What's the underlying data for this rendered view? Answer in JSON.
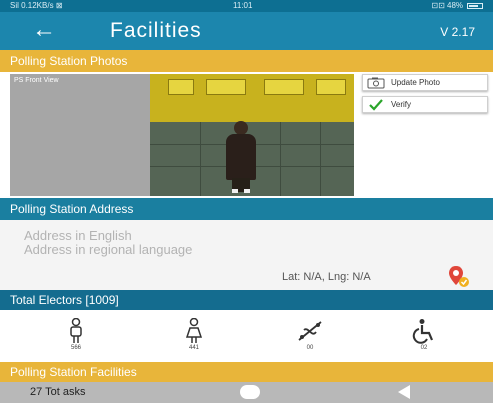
{
  "status_bar": {
    "left_text": "Sil 0.12KB/s ⊠",
    "time": "11:01",
    "right_text": "⊡⊡ 48%"
  },
  "app_bar": {
    "back_icon": "back-arrow-icon",
    "title": "Facilities",
    "version": "V 2.17"
  },
  "photos_section": {
    "header": "Polling Station Photos",
    "label": "PS Front View",
    "update_button": "Update Photo",
    "verify_button": "Verify"
  },
  "address_section": {
    "header": "Polling Station Address",
    "address_english_placeholder": "Address in English",
    "address_regional_placeholder": "Address in regional language",
    "latlng": "Lat: N/A, Lng: N/A"
  },
  "electors_section": {
    "header": "Total Electors [1009]",
    "items": [
      {
        "icon": "male-icon",
        "count": "566"
      },
      {
        "icon": "female-icon",
        "count": "441"
      },
      {
        "icon": "third-gender-icon",
        "count": "00"
      },
      {
        "icon": "wheelchair-icon",
        "count": "02"
      }
    ]
  },
  "facilities_section": {
    "header": "Polling Station Facilities"
  },
  "nav_bar": {
    "toast": "27 Tot     asks"
  },
  "colors": {
    "primary": "#1c86ad",
    "accent": "#e8b53a",
    "secondary": "#146c8f"
  }
}
